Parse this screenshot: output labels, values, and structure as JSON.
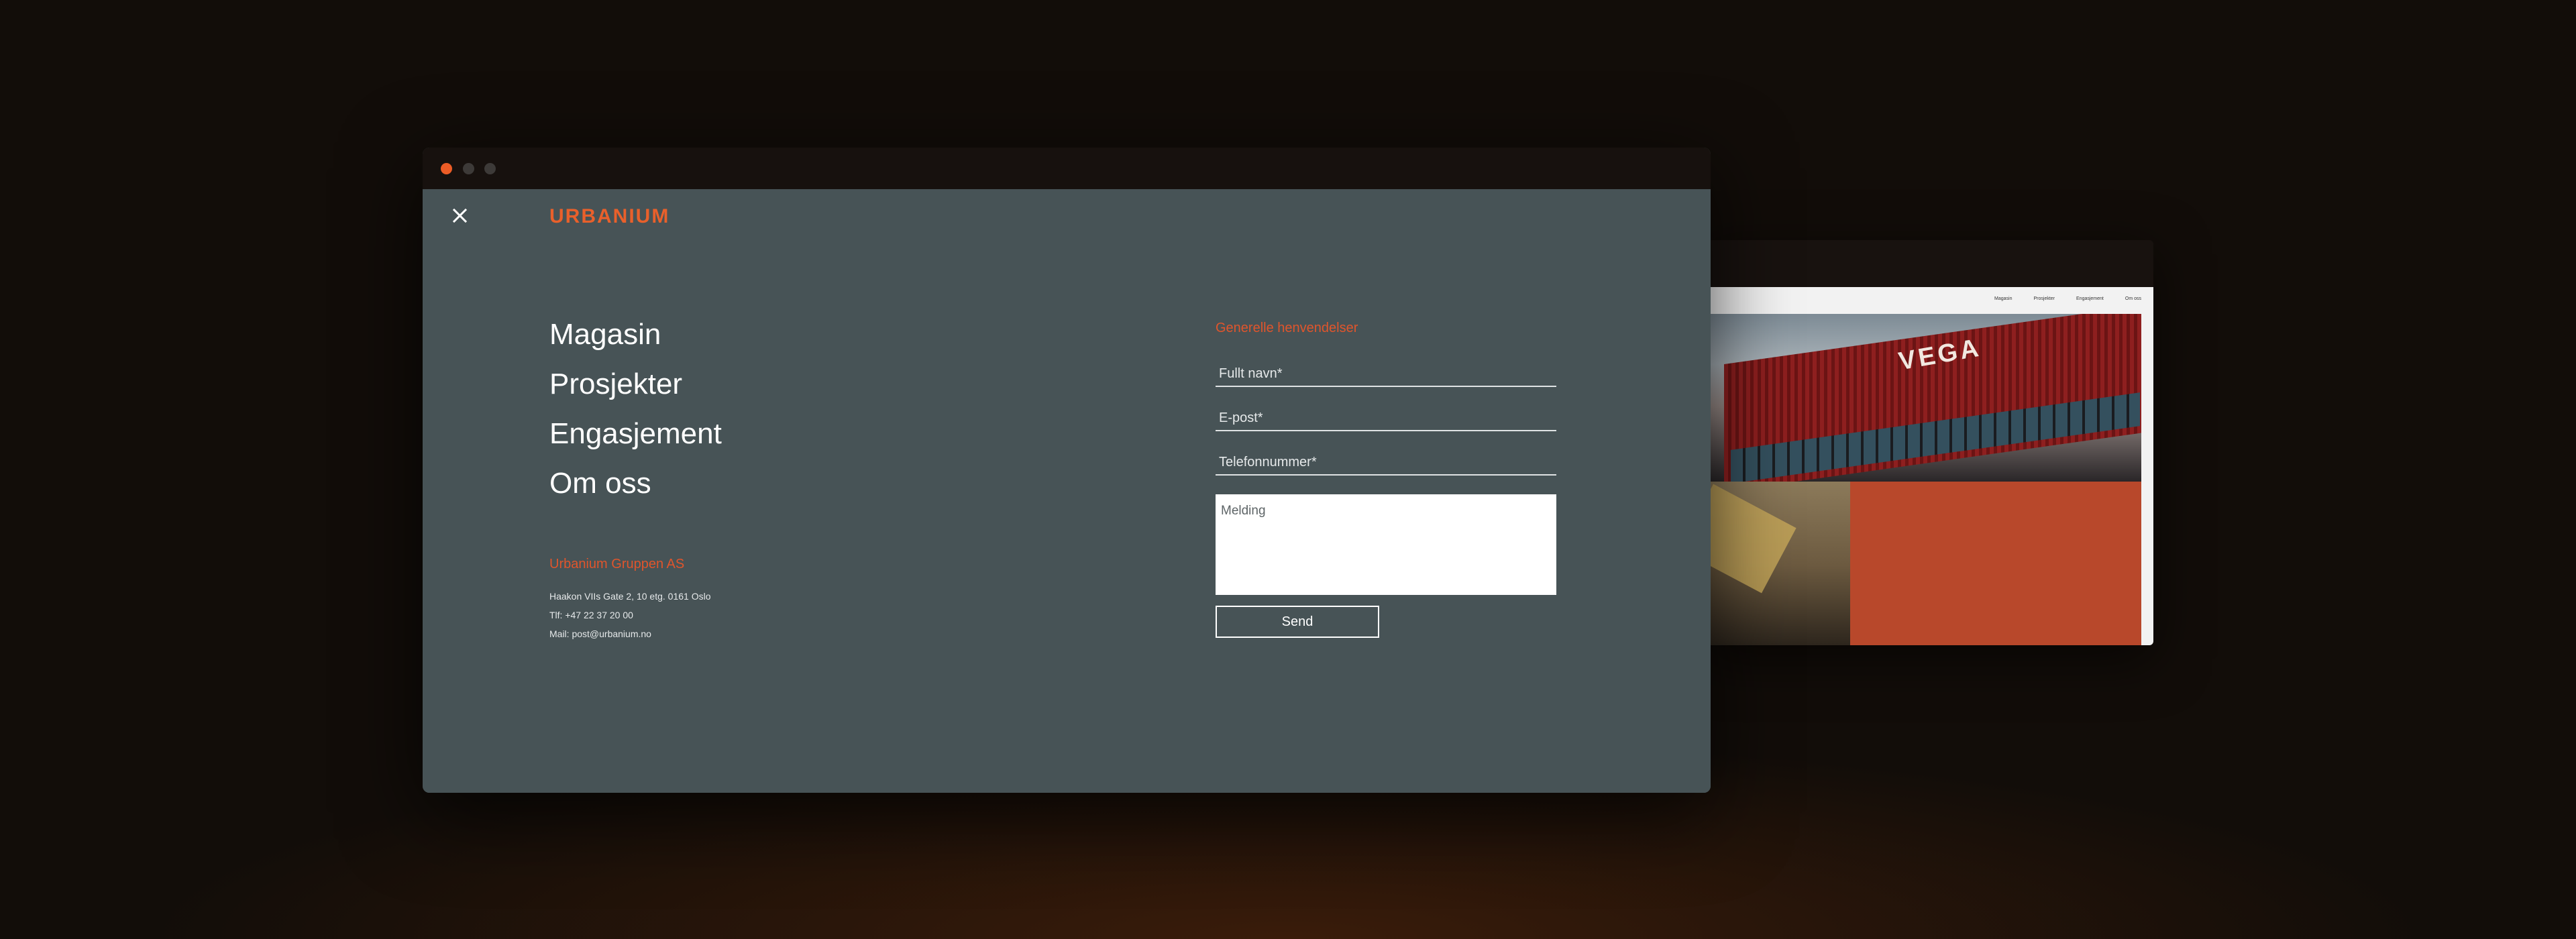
{
  "window": {
    "controls": {
      "close_color": "#ec5c26",
      "inactive_color": "#3d3a38"
    }
  },
  "header": {
    "logo": "URBANIUM",
    "close_icon": "close-icon"
  },
  "menu": {
    "items": [
      {
        "label": "Magasin"
      },
      {
        "label": "Prosjekter"
      },
      {
        "label": "Engasjement"
      },
      {
        "label": "Om oss"
      }
    ]
  },
  "company": {
    "name": "Urbanium Gruppen AS",
    "address": "Haakon VIIs Gate 2, 10 etg. 0161 Oslo",
    "phone": "Tlf: +47 22 37 20 00",
    "email": "Mail: post@urbanium.no"
  },
  "contact_form": {
    "heading": "Generelle henvendelser",
    "name_placeholder": "Fullt navn*",
    "email_placeholder": "E-post*",
    "phone_placeholder": "Telefonnummer*",
    "message_placeholder": "Melding",
    "submit_label": "Send"
  },
  "background_window": {
    "nav": [
      "Magasin",
      "Prosjekter",
      "Engasjement",
      "Om oss"
    ],
    "building_sign": "VEGA"
  },
  "colors": {
    "accent": "#e9602b",
    "panel_bg": "#475356",
    "page_bg": "#120d09",
    "tile_orange": "#b8482b"
  }
}
